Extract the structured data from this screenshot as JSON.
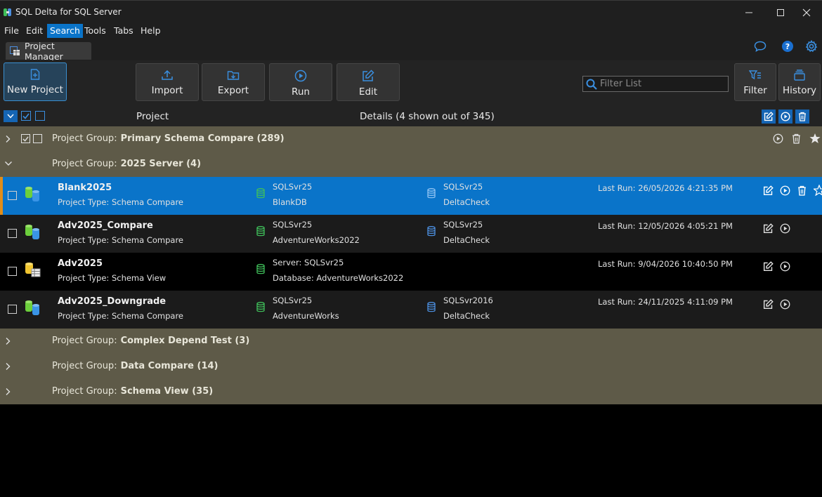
{
  "window": {
    "title": "SQL Delta for SQL Server"
  },
  "menu": [
    "File",
    "Edit",
    "Search",
    "Tools",
    "Tabs",
    "Help"
  ],
  "tab": {
    "label": "Project Manager"
  },
  "toolbar": {
    "new_project": "New Project",
    "import": "Import",
    "export": "Export",
    "run": "Run",
    "edit": "Edit",
    "filter_placeholder": "Filter List",
    "filter": "Filter",
    "history": "History"
  },
  "header": {
    "project": "Project",
    "details": "Details  (4 shown out of 345)"
  },
  "groups": [
    {
      "prefix": "Project Group:",
      "name": "Primary Schema Compare (289)"
    },
    {
      "prefix": "Project Group:",
      "name": "2025 Server (4)"
    },
    {
      "prefix": "Project Group:",
      "name": "Complex Depend Test (3)"
    },
    {
      "prefix": "Project Group:",
      "name": "Data Compare (14)"
    },
    {
      "prefix": "Project Group:",
      "name": "Schema View (35)"
    }
  ],
  "projects": [
    {
      "name": "Blank2025",
      "type": "Project Type: Schema Compare",
      "src1": "SQLSvr25",
      "src2": "BlankDB",
      "tgt1": "SQLSvr25",
      "tgt2": "DeltaCheck",
      "last_run": "Last Run: 26/05/2026 4:21:35 PM"
    },
    {
      "name": "Adv2025_Compare",
      "type": "Project Type: Schema Compare",
      "src1": "SQLSvr25",
      "src2": "AdventureWorks2022",
      "tgt1": "SQLSvr25",
      "tgt2": "DeltaCheck",
      "last_run": "Last Run: 12/05/2026 4:05:21 PM"
    },
    {
      "name": "Adv2025",
      "type": "Project Type: Schema View",
      "src1": "Server: SQLSvr25",
      "src2": "Database:  AdventureWorks2022",
      "tgt1": "",
      "tgt2": "",
      "last_run": "Last Run: 9/04/2026 10:40:50 PM"
    },
    {
      "name": "Adv2025_Downgrade",
      "type": "Project Type: Schema Compare",
      "src1": "SQLSvr25",
      "src2": "AdventureWorks",
      "tgt1": "SQLSvr2016",
      "tgt2": "DeltaCheck",
      "last_run": "Last Run: 24/11/2025 4:11:09 PM"
    }
  ],
  "colors": {
    "accent": "#0a74c9",
    "group_bg": "#5e5a48",
    "selected_marker": "#e08d1a",
    "source_db": "#3fbf5a",
    "target_db": "#4c8fe0"
  }
}
